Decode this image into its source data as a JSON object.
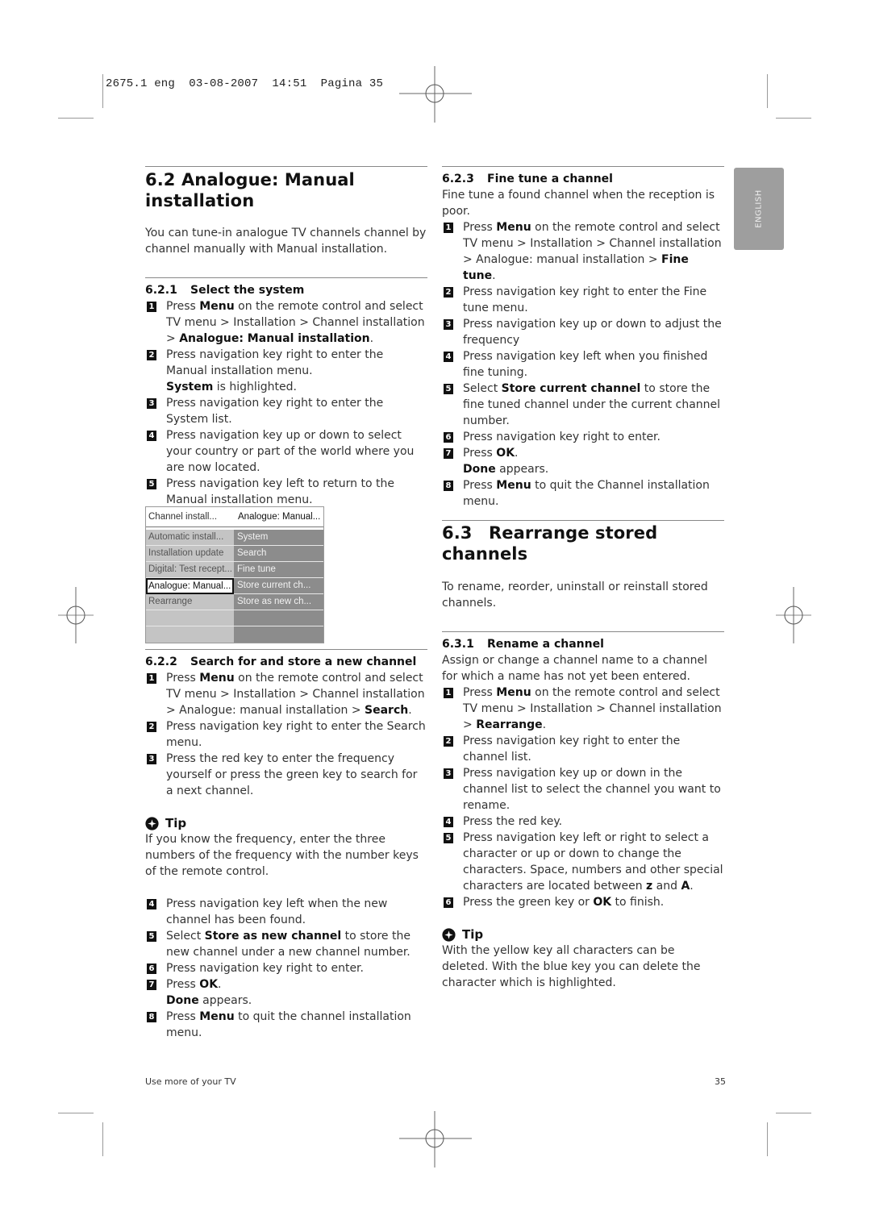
{
  "slug": {
    "text": "2675.1 eng  03-08-2007  14:51  Pagina 35"
  },
  "language_tab": {
    "label": "ENGLISH"
  },
  "section_6_2": {
    "number": "6.2",
    "title": "Analogue: Manual installation",
    "intro": "You can tune-in analogue TV channels channel by channel manually with Manual installation.",
    "sub_6_2_1": {
      "number": "6.2.1",
      "title": "Select the system",
      "steps": [
        {
          "n": "1",
          "pre": "Press ",
          "b1": "Menu",
          "mid": " on the remote control and select TV menu > Installation > Channel installation > ",
          "b2": "Analogue: Manual installation",
          "post": "."
        },
        {
          "n": "2",
          "pre": "Press navigation key right to enter the Manual installation menu.",
          "b1": "System",
          "post": " is highlighted."
        },
        {
          "n": "3",
          "text": "Press navigation key right to enter the System list."
        },
        {
          "n": "4",
          "text": "Press navigation key up or down to select your country or part of the world where you are now located."
        },
        {
          "n": "5",
          "text": "Press navigation key left to return to the Manual installation menu."
        }
      ]
    },
    "menu": {
      "header_left": "Channel install...",
      "header_right": "Analogue: Manual...",
      "left_items": [
        "Automatic install...",
        "Installation update",
        "Digital: Test recept...",
        "Analogue: Manual...",
        "Rearrange",
        "",
        ""
      ],
      "right_items": [
        "System",
        "Search",
        "Fine tune",
        "Store current ch...",
        "Store as new ch...",
        "",
        ""
      ],
      "selected_left_index": 3
    },
    "sub_6_2_2": {
      "number": "6.2.2",
      "title": "Search for and store a new channel",
      "steps_a": [
        {
          "n": "1",
          "pre": "Press ",
          "b1": "Menu",
          "mid": " on the remote control and select TV menu > Installation > Channel installation > Analogue: manual installation > ",
          "b2": "Search",
          "post": "."
        },
        {
          "n": "2",
          "text": "Press navigation key right to enter the Search menu."
        },
        {
          "n": "3",
          "text": "Press the red key to enter the frequency yourself or press the green key to search for a next channel."
        }
      ],
      "tip": {
        "label": "Tip",
        "text": "If you know the frequency, enter the three numbers of the frequency with the number keys of the remote control."
      },
      "steps_b": [
        {
          "n": "4",
          "text": "Press navigation key left when the new channel has been found."
        },
        {
          "n": "5",
          "pre": "Select ",
          "b1": "Store as new channel",
          "post": " to store the new channel under a new channel number."
        },
        {
          "n": "6",
          "text": "Press navigation key right to enter."
        },
        {
          "n": "7",
          "pre": "Press ",
          "b1": "OK",
          "post": ".",
          "line2_b": "Done",
          "line2_post": " appears."
        },
        {
          "n": "8",
          "pre": "Press ",
          "b1": "Menu",
          "post": " to quit the channel installation menu."
        }
      ]
    },
    "sub_6_2_3": {
      "number": "6.2.3",
      "title": "Fine tune a channel",
      "intro": "Fine tune a found channel when the reception is poor.",
      "steps": [
        {
          "n": "1",
          "pre": "Press ",
          "b1": "Menu",
          "mid": " on the remote control and select TV menu > Installation > Channel installation > Analogue: manual installation > ",
          "b2": "Fine tune",
          "post": "."
        },
        {
          "n": "2",
          "text": "Press navigation key right to enter the Fine tune menu."
        },
        {
          "n": "3",
          "text": "Press navigation key up or down to adjust the frequency"
        },
        {
          "n": "4",
          "text": "Press navigation key left when you finished fine tuning."
        },
        {
          "n": "5",
          "pre": "Select ",
          "b1": "Store current channel",
          "post": " to store the fine tuned channel under the current channel number."
        },
        {
          "n": "6",
          "text": "Press navigation key right to enter."
        },
        {
          "n": "7",
          "pre": "Press ",
          "b1": "OK",
          "post": ".",
          "line2_b": "Done",
          "line2_post": " appears."
        },
        {
          "n": "8",
          "pre": "Press ",
          "b1": "Menu",
          "post": " to quit the Channel installation menu."
        }
      ]
    }
  },
  "section_6_3": {
    "number": "6.3",
    "title": "Rearrange stored channels",
    "intro": "To rename, reorder, uninstall or reinstall stored channels.",
    "sub_6_3_1": {
      "number": "6.3.1",
      "title": "Rename a channel",
      "intro": "Assign or change a channel name to a channel for which a name has not yet been entered.",
      "steps": [
        {
          "n": "1",
          "pre": "Press ",
          "b1": "Menu",
          "mid": " on the remote control and select TV menu > Installation > Channel installation > ",
          "b2": "Rearrange",
          "post": "."
        },
        {
          "n": "2",
          "text": "Press navigation key right to enter the channel list."
        },
        {
          "n": "3",
          "text": "Press navigation key up or down in the channel list to select the channel you want to rename."
        },
        {
          "n": "4",
          "text": "Press the red key."
        },
        {
          "n": "5",
          "pre": "Press navigation key left or right to select a character or up or down to change the characters. Space, numbers and other special characters are located between ",
          "b1": "z",
          "mid": " and ",
          "b2": "A",
          "post": "."
        },
        {
          "n": "6",
          "pre": "Press the green key or ",
          "b1": "OK",
          "post": " to finish."
        }
      ],
      "tip": {
        "label": "Tip",
        "text": "With the yellow key all characters can be deleted. With the blue key you can delete the character which is highlighted."
      }
    }
  },
  "footer": {
    "left": "Use more of your TV",
    "page_number": "35"
  }
}
